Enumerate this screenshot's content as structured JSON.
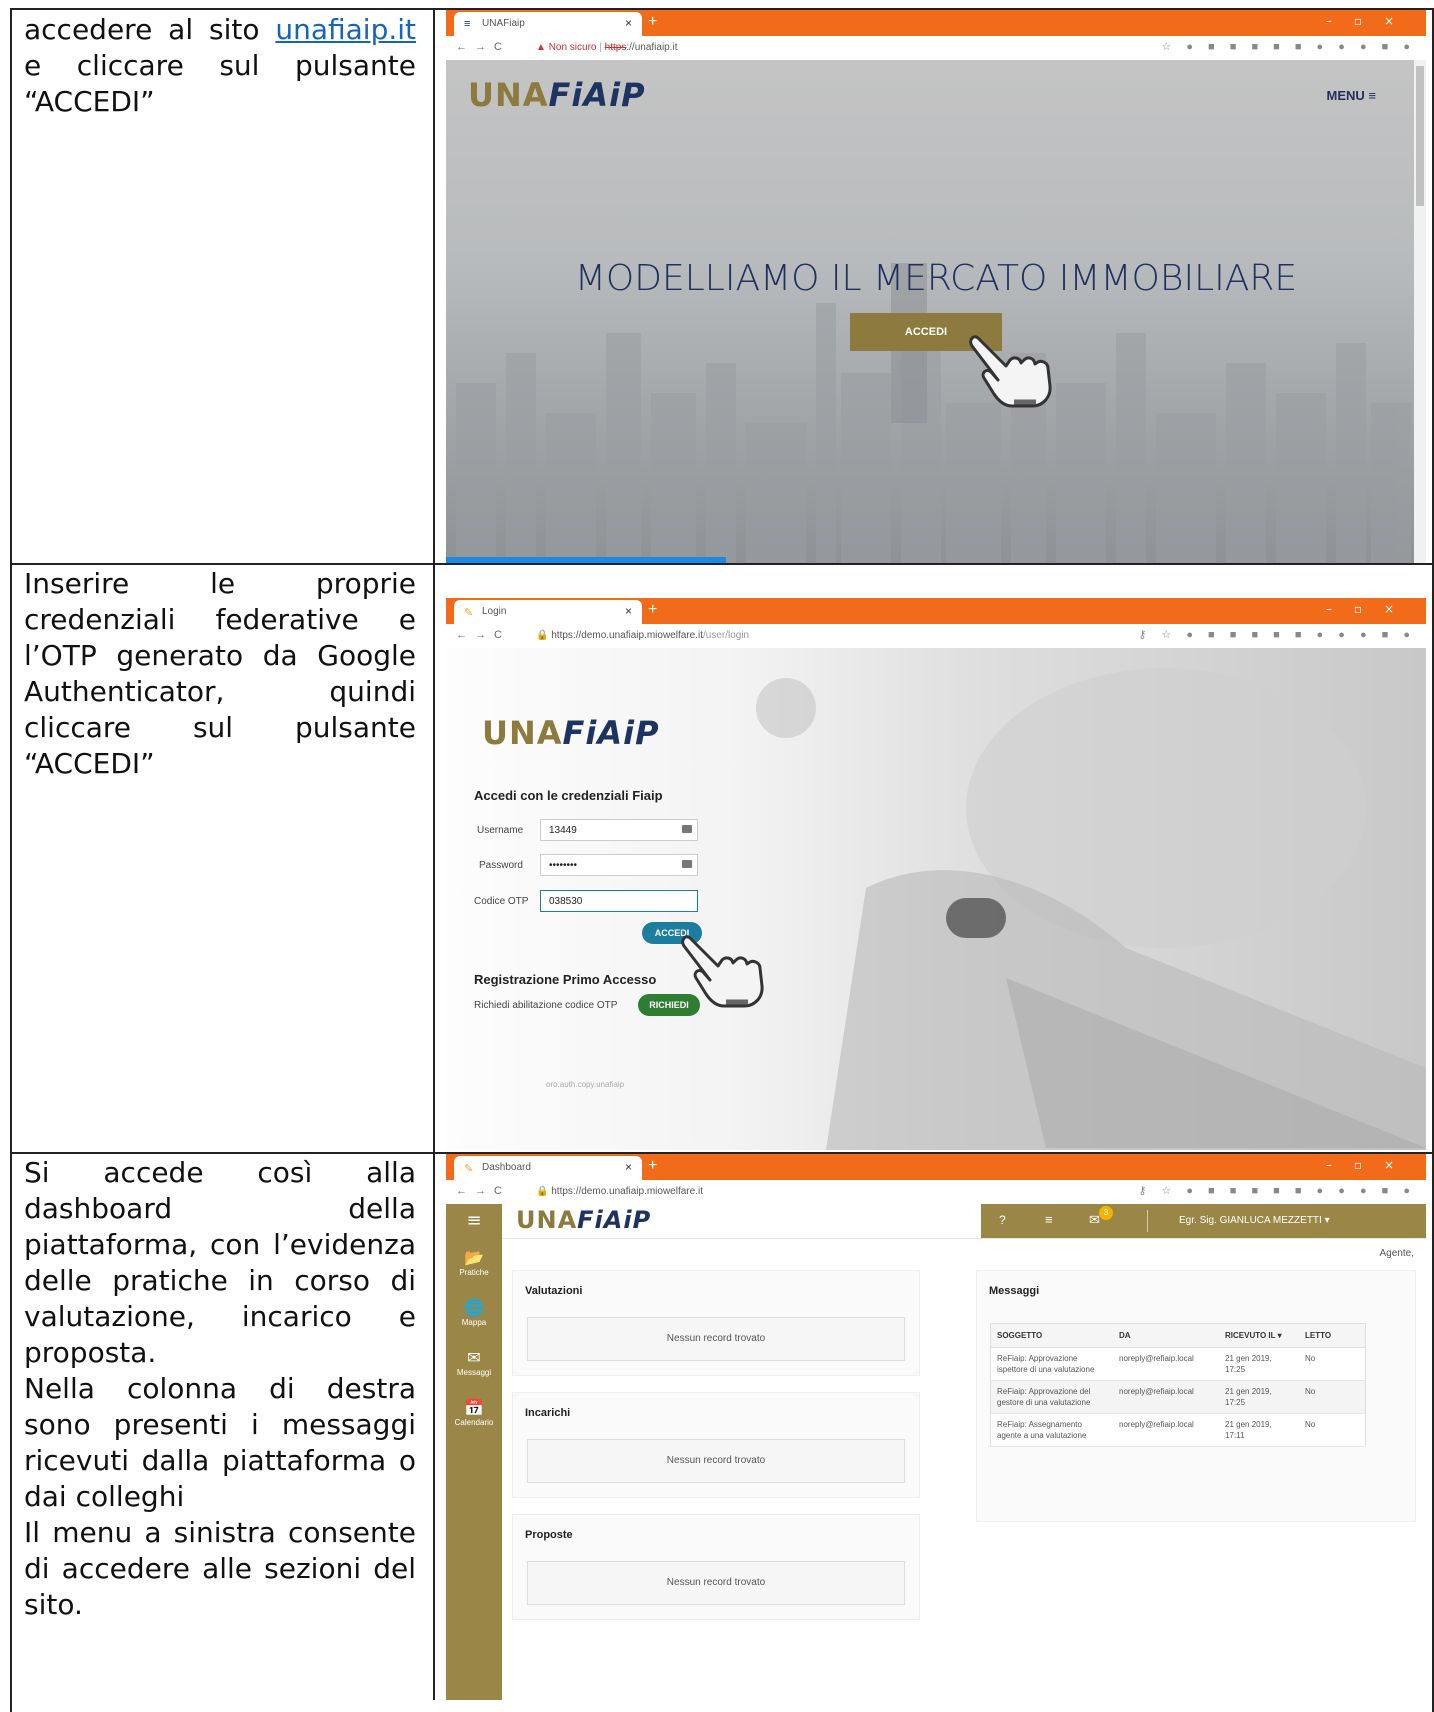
{
  "rows": [
    {
      "instruction_pre": "accedere al sito ",
      "instruction_link": "unafiaip.it",
      "instruction_post": " e cliccare sul pulsante “ACCEDI”",
      "browser": {
        "tab_title": "UNAFiaip",
        "not_secure": "Non sicuro",
        "url_scheme": "https",
        "url_rest": "://unafiaip.it"
      },
      "page": {
        "logo_una": "UNA",
        "logo_fiaip": "FiAiP",
        "menu_label": "MENU ≡",
        "hero_title": "MODELLIAMO IL MERCATO IMMOBILIARE",
        "accedi_label": "ACCEDI"
      }
    },
    {
      "instruction": "Inserire le proprie credenziali federative e l’OTP generato da Google Authenticator, quindi cliccare sul pulsante “ACCEDI”",
      "browser": {
        "tab_title": "Login",
        "url": "https://demo.unafiaip.miowelfare.it",
        "url_path": "/user/login"
      },
      "page": {
        "logo_una": "UNA",
        "logo_fiaip": "FiAiP",
        "form_title": "Accedi con le credenziali Fiaip",
        "username_label": "Username",
        "username_value": "13449",
        "password_label": "Password",
        "password_value": "••••••••",
        "otp_label": "Codice OTP",
        "otp_value": "038530",
        "accedi_label": "ACCEDI",
        "reg_title": "Registrazione Primo Accesso",
        "reg_text": "Richiedi abilitazione codice OTP",
        "richiedi_label": "RICHIEDI",
        "footer_text": "oro.auth.copy.unafiaip"
      }
    },
    {
      "instruction_lines": [
        "Si accede così alla dashboard della piattaforma, con l’evidenza delle pratiche in corso di valutazione, incarico e proposta.",
        "Nella colonna di destra sono presenti i messaggi ricevuti dalla piattaforma o dai colleghi",
        "Il menu a sinistra consente di accedere alle sezioni del sito."
      ],
      "browser": {
        "tab_title": "Dashboard",
        "url": "https://demo.unafiaip.miowelfare.it"
      },
      "app": {
        "logo_una": "UNA",
        "logo_fiaip": "FiAiP",
        "badge_count": "3",
        "user_label": "Egr. Sig. GIANLUCA MEZZETTI",
        "role_label": "Agente,",
        "sidebar": [
          {
            "icon": "folder-icon",
            "glyph": "📂",
            "label": "Pratiche"
          },
          {
            "icon": "globe-icon",
            "glyph": "🌐",
            "label": "Mappa"
          },
          {
            "icon": "envelope-icon",
            "glyph": "✉",
            "label": "Messaggi"
          },
          {
            "icon": "calendar-icon",
            "glyph": "📅",
            "label": "Calendario"
          }
        ],
        "sections": [
          {
            "title": "Valutazioni",
            "empty": "Nessun record trovato"
          },
          {
            "title": "Incarichi",
            "empty": "Nessun record trovato"
          },
          {
            "title": "Proposte",
            "empty": "Nessun record trovato"
          }
        ],
        "messages": {
          "title": "Messaggi",
          "columns": [
            "SOGGETTO",
            "DA",
            "RICEVUTO IL ▾",
            "LETTO"
          ],
          "rows": [
            [
              "ReFiaip: Approvazione ispettore di una valutazione",
              "noreply@refiaip.local",
              "21 gen 2019, 17:25",
              "No"
            ],
            [
              "ReFiaip: Approvazione del gestore di una valutazione",
              "noreply@refiaip.local",
              "21 gen 2019, 17:25",
              "No"
            ],
            [
              "ReFiaip: Assegnamento agente a una valutazione",
              "noreply@refiaip.local",
              "21 gen 2019, 17:11",
              "No"
            ]
          ]
        }
      }
    }
  ],
  "colors": {
    "tabbar": "#f26b1a",
    "gold": "#9a8747",
    "navy": "#1d3361",
    "teal": "#1b7ea1",
    "green": "#2e7d32"
  }
}
